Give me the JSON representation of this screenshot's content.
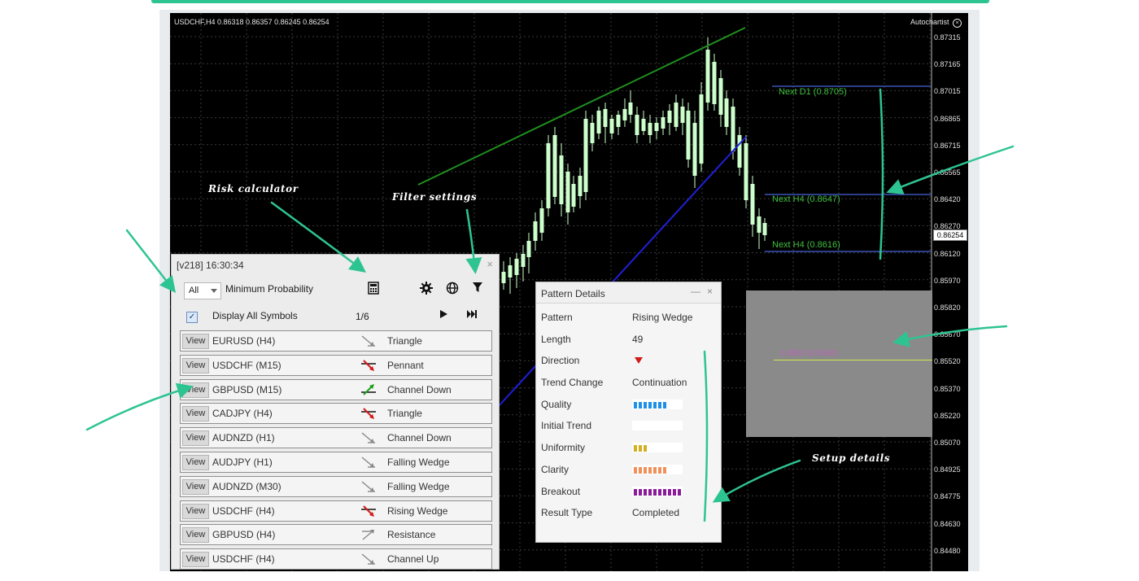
{
  "chart": {
    "symbol_info": "USDCHF,H4  0.86318 0.86357 0.86245 0.86254",
    "autochartist_label": "Autochartist",
    "price_axis": [
      "0.87315",
      "0.87165",
      "0.87015",
      "0.86865",
      "0.86715",
      "0.86565",
      "0.86420",
      "0.86270",
      "0.86120",
      "0.85970",
      "0.85820",
      "0.85670",
      "0.85520",
      "0.85370",
      "0.85220",
      "0.85070",
      "0.84925",
      "0.84775",
      "0.84630",
      "0.84480"
    ],
    "current_price": "0.86254",
    "levels": [
      {
        "label": "Next D1 (0.8705)"
      },
      {
        "label": "Next H4 (0.8647)"
      },
      {
        "label": "Next H4 (0.8616)"
      }
    ],
    "forecast_label": "0.8560 (0.8560)",
    "colors": {
      "candle": "#ccffcc",
      "wedge_upper": "#1f8f1f",
      "wedge_lower": "#1f1fd8",
      "level_line": "#3a52b8",
      "level_text": "#3fbf3f"
    }
  },
  "scanner": {
    "title": "[v218] 16:30:34",
    "close": "×",
    "filter_value": "All",
    "min_probability_label": "Minimum Probability",
    "display_all_label": "Display All Symbols",
    "page_indicator": "1/6",
    "tools": [
      "calculator-icon",
      "gear-icon",
      "globe-icon",
      "filter-icon",
      "play-icon",
      "fast-forward-icon"
    ],
    "rows": [
      {
        "view": "View",
        "symbol": "EURUSD (H4)",
        "pattern": "Triangle",
        "icon": "gray"
      },
      {
        "view": "View",
        "symbol": "USDCHF (M15)",
        "pattern": "Pennant",
        "icon": "red"
      },
      {
        "view": "View",
        "symbol": "GBPUSD (M15)",
        "pattern": "Channel Down",
        "icon": "green"
      },
      {
        "view": "View",
        "symbol": "CADJPY (H4)",
        "pattern": "Triangle",
        "icon": "red"
      },
      {
        "view": "View",
        "symbol": "AUDNZD (H1)",
        "pattern": "Channel Down",
        "icon": "gray"
      },
      {
        "view": "View",
        "symbol": "AUDJPY (H1)",
        "pattern": "Falling Wedge",
        "icon": "gray"
      },
      {
        "view": "View",
        "symbol": "AUDNZD (M30)",
        "pattern": "Falling Wedge",
        "icon": "gray"
      },
      {
        "view": "View",
        "symbol": "USDCHF (H4)",
        "pattern": "Rising Wedge",
        "icon": "red"
      },
      {
        "view": "View",
        "symbol": "GBPUSD (H4)",
        "pattern": "Resistance",
        "icon": "gray-up"
      },
      {
        "view": "View",
        "symbol": "USDCHF (H4)",
        "pattern": "Channel Up",
        "icon": "gray"
      }
    ]
  },
  "details": {
    "title": "Pattern Details",
    "minimize": "—",
    "close": "×",
    "fields": [
      {
        "key": "Pattern",
        "value": "Rising Wedge"
      },
      {
        "key": "Length",
        "value": "49"
      },
      {
        "key": "Direction",
        "value": "",
        "arrow": "down"
      },
      {
        "key": "Trend Change",
        "value": "Continuation"
      },
      {
        "key": "Quality",
        "value": "",
        "bar": {
          "level": 7,
          "color": "#1e90e8"
        }
      },
      {
        "key": "Initial Trend",
        "value": "",
        "bar": {
          "level": 0,
          "color": "#1e90e8"
        }
      },
      {
        "key": "Uniformity",
        "value": "",
        "bar": {
          "level": 3,
          "color": "#d4b020"
        }
      },
      {
        "key": "Clarity",
        "value": "",
        "bar": {
          "level": 7,
          "color": "#f0905a"
        }
      },
      {
        "key": "Breakout",
        "value": "",
        "bar": {
          "level": 10,
          "color": "#8a1a9a"
        }
      },
      {
        "key": "Result Type",
        "value": "Completed"
      }
    ]
  },
  "annotations": {
    "risk_calculator": "Risk calculator",
    "filter_settings": "Filter settings",
    "setup_details": "Setup details",
    "accent_color": "#2ec492"
  }
}
